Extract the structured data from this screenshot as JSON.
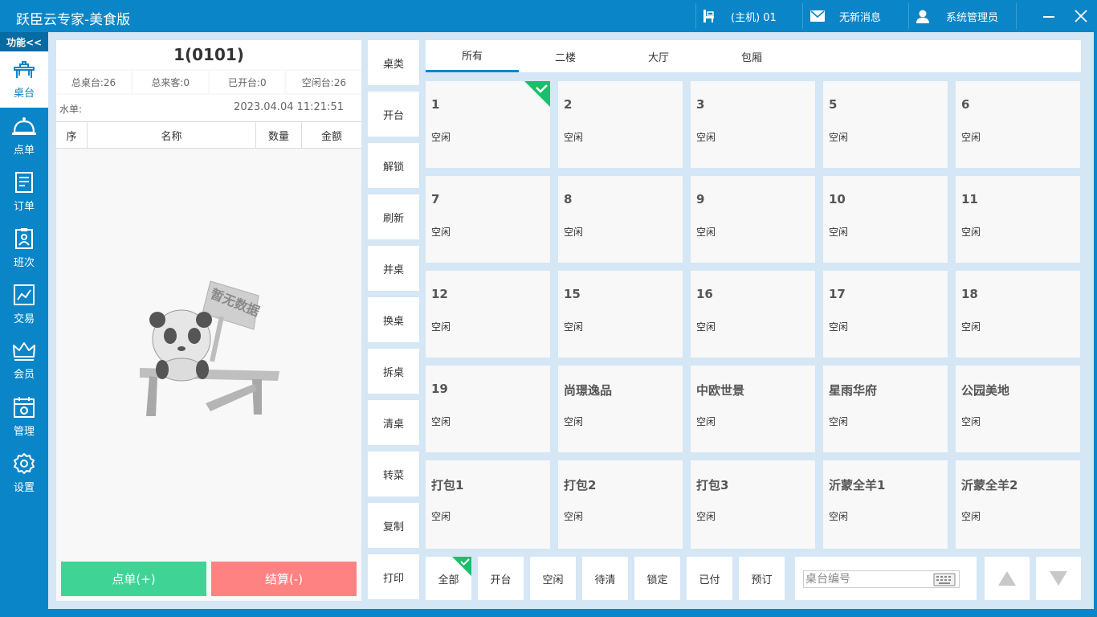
{
  "app": {
    "title": "跃臣云专家-美食版"
  },
  "titlebar": {
    "host_label": "(主机) 01",
    "message_label": "无新消息",
    "user_label": "系统管理员"
  },
  "nav": {
    "func_label": "功能<<",
    "items": [
      {
        "label": "桌台",
        "icon": "table-icon"
      },
      {
        "label": "点单",
        "icon": "bell-icon"
      },
      {
        "label": "订单",
        "icon": "order-icon"
      },
      {
        "label": "班次",
        "icon": "shift-icon"
      },
      {
        "label": "交易",
        "icon": "trade-icon"
      },
      {
        "label": "会员",
        "icon": "crown-icon"
      },
      {
        "label": "管理",
        "icon": "calendar-icon"
      },
      {
        "label": "设置",
        "icon": "gear-icon"
      }
    ]
  },
  "order": {
    "table_number": "1(0101)",
    "stats": [
      "总桌台:26",
      "总来客:0",
      "已开台:0",
      "空闲台:26"
    ],
    "water_label": "水单:",
    "datetime": "2023.04.04 11:21:51",
    "columns": [
      "序",
      "名称",
      "数量",
      "金额"
    ],
    "empty_text": "暂无数据",
    "order_button": "点单(+)",
    "pay_button": "结算(-)"
  },
  "functions": [
    "桌类",
    "开台",
    "解锁",
    "刷新",
    "并桌",
    "换桌",
    "拆桌",
    "清桌",
    "转菜",
    "复制",
    "打印"
  ],
  "areas": [
    "所有",
    "二楼",
    "大厅",
    "包厢"
  ],
  "tables": [
    {
      "name": "1",
      "status": "空闲"
    },
    {
      "name": "2",
      "status": "空闲"
    },
    {
      "name": "3",
      "status": "空闲"
    },
    {
      "name": "5",
      "status": "空闲"
    },
    {
      "name": "6",
      "status": "空闲"
    },
    {
      "name": "7",
      "status": "空闲"
    },
    {
      "name": "8",
      "status": "空闲"
    },
    {
      "name": "9",
      "status": "空闲"
    },
    {
      "name": "10",
      "status": "空闲"
    },
    {
      "name": "11",
      "status": "空闲"
    },
    {
      "name": "12",
      "status": "空闲"
    },
    {
      "name": "15",
      "status": "空闲"
    },
    {
      "name": "16",
      "status": "空闲"
    },
    {
      "name": "17",
      "status": "空闲"
    },
    {
      "name": "18",
      "status": "空闲"
    },
    {
      "name": "19",
      "status": "空闲"
    },
    {
      "name": "尚璟逸品",
      "status": "空闲"
    },
    {
      "name": "中欧世景",
      "status": "空闲"
    },
    {
      "name": "星雨华府",
      "status": "空闲"
    },
    {
      "name": "公园美地",
      "status": "空闲"
    },
    {
      "name": "打包1",
      "status": "空闲"
    },
    {
      "name": "打包2",
      "status": "空闲"
    },
    {
      "name": "打包3",
      "status": "空闲"
    },
    {
      "name": "沂蒙全羊1",
      "status": "空闲"
    },
    {
      "name": "沂蒙全羊2",
      "status": "空闲"
    }
  ],
  "filters": [
    "全部",
    "开台",
    "空闲",
    "待清",
    "锁定",
    "已付",
    "预订"
  ],
  "search": {
    "placeholder": "桌台编号"
  },
  "colors": {
    "primary": "#0a85c7",
    "order_green": "#3fd495",
    "pay_red": "#ff8282",
    "check_green": "#1bbf6b"
  }
}
